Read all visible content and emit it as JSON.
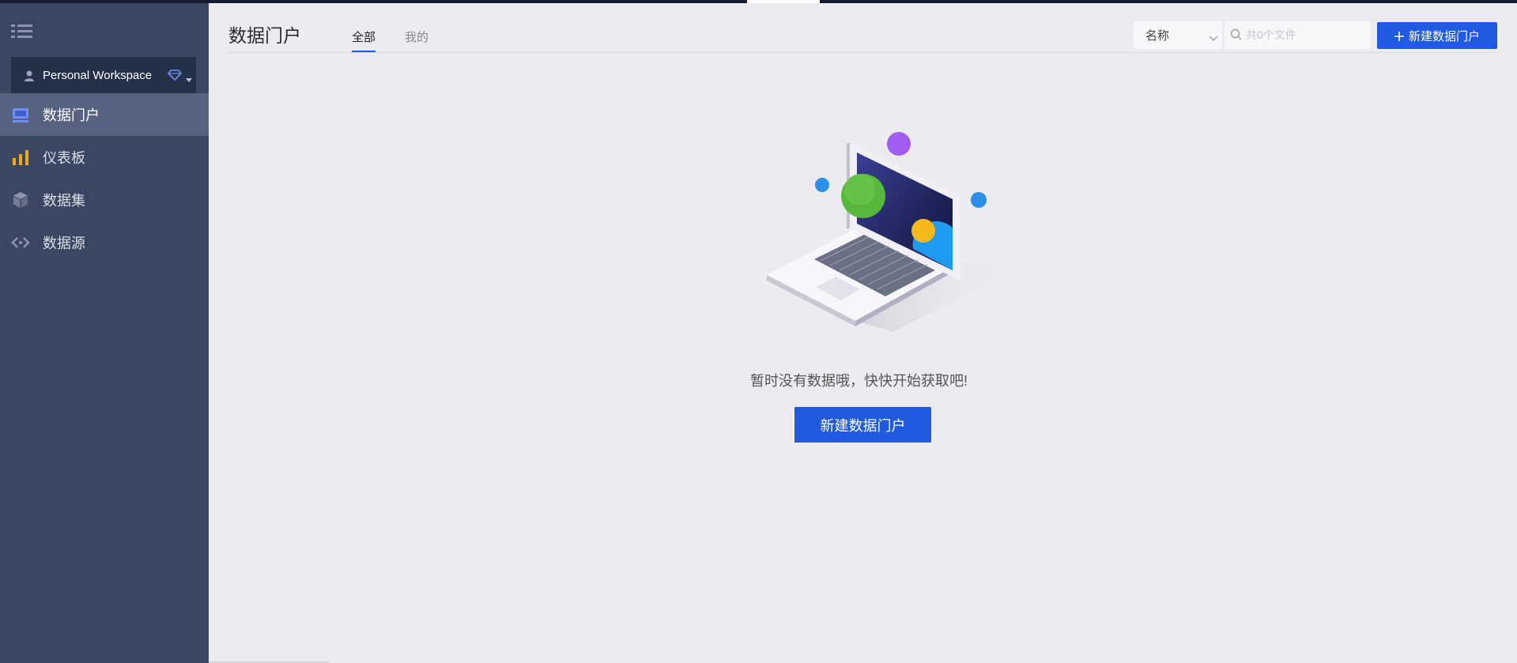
{
  "sidebar": {
    "workspace": {
      "label": "Personal Workspace"
    },
    "items": [
      {
        "label": "数据门户",
        "icon": "portal-icon",
        "active": true
      },
      {
        "label": "仪表板",
        "icon": "bar-chart-icon",
        "active": false
      },
      {
        "label": "数据集",
        "icon": "cube-icon",
        "active": false
      },
      {
        "label": "数据源",
        "icon": "datasource-icon",
        "active": false
      }
    ]
  },
  "header": {
    "title": "数据门户",
    "tabs": [
      {
        "label": "全部",
        "active": true
      },
      {
        "label": "我的",
        "active": false
      }
    ],
    "sort": {
      "selected": "名称"
    },
    "search": {
      "placeholder": "共0个文件",
      "value": ""
    },
    "new_button": "新建数据门户"
  },
  "empty_state": {
    "message": "暂时没有数据哦，快快开始获取吧!",
    "button": "新建数据门户"
  },
  "colors": {
    "sidebar_bg": "#3b4762",
    "sidebar_active": "#56627f",
    "workspace_bg": "#253049",
    "primary": "#1f5ae0",
    "content_bg": "#ecebf0"
  }
}
